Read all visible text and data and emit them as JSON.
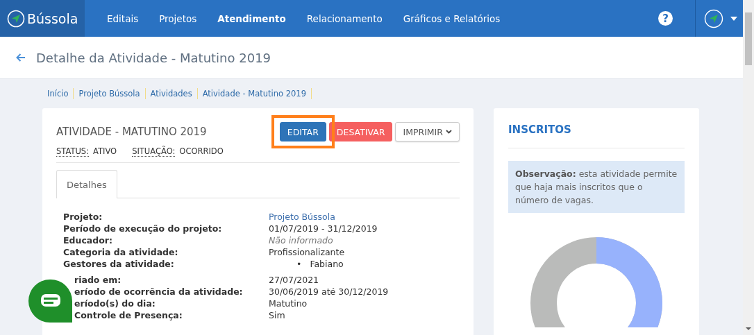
{
  "nav": {
    "logo": "Bússola",
    "help": "?",
    "items": [
      {
        "label": "Editais",
        "selected": false
      },
      {
        "label": "Projetos",
        "selected": false
      },
      {
        "label": "Atendimento",
        "selected": true
      },
      {
        "label": "Relacionamento",
        "selected": false
      },
      {
        "label": "Gráficos e Relatórios",
        "selected": false
      }
    ]
  },
  "page_title": "Detalhe da Atividade - Matutino 2019",
  "breadcrumb": [
    "Início",
    "Projeto Bússola",
    "Atividades",
    "Atividade - Matutino 2019"
  ],
  "activity": {
    "title": "ATIVIDADE - MATUTINO 2019",
    "fields": [
      {
        "label": "STATUS:",
        "value": "ATIVO"
      },
      {
        "label": "SITUAÇÃO:",
        "value": "OCORRIDO"
      }
    ],
    "buttons": [
      {
        "label": "EDITAR",
        "kind": "primary",
        "highlighted": true
      },
      {
        "label": "DESATIVAR",
        "kind": "danger",
        "highlighted": false
      },
      {
        "label": "IMPRIMIR",
        "kind": "dropdown",
        "highlighted": false
      }
    ],
    "tabs": [
      {
        "label": "Detalhes",
        "selected": true
      }
    ],
    "sections": [
      {
        "rows": [
          {
            "label": "Projeto:",
            "kind": "link",
            "value": "Projeto Bússola"
          },
          {
            "label": "Período de execução do projeto:",
            "kind": "text",
            "value": "01/07/2019 - 31/12/2019"
          },
          {
            "label": "Educador:",
            "kind": "empty",
            "value": "Não informado"
          },
          {
            "label": "Categoria da atividade:",
            "kind": "text",
            "value": "Profissionalizante"
          },
          {
            "label": "Gestores da atividade:",
            "kind": "list",
            "bullet": "•",
            "items": [
              "Fabiano"
            ]
          }
        ]
      },
      {
        "rows": [
          {
            "label": "riado em:",
            "kind": "text",
            "value": "27/07/2021"
          },
          {
            "label": "eríodo de ocorrência da atividade:",
            "kind": "text",
            "value": "30/06/2019 até 30/12/2019"
          },
          {
            "label": "eríodo(s) do dia:",
            "kind": "text",
            "value": "Matutino"
          },
          {
            "label": "Controle de Presença:",
            "kind": "text",
            "value": "Sim"
          }
        ]
      }
    ]
  },
  "inscritos": {
    "title": "INSCRITOS",
    "note": "**Observação:** esta atividade permite que haja mais inscritos que o número de vagas."
  }
}
